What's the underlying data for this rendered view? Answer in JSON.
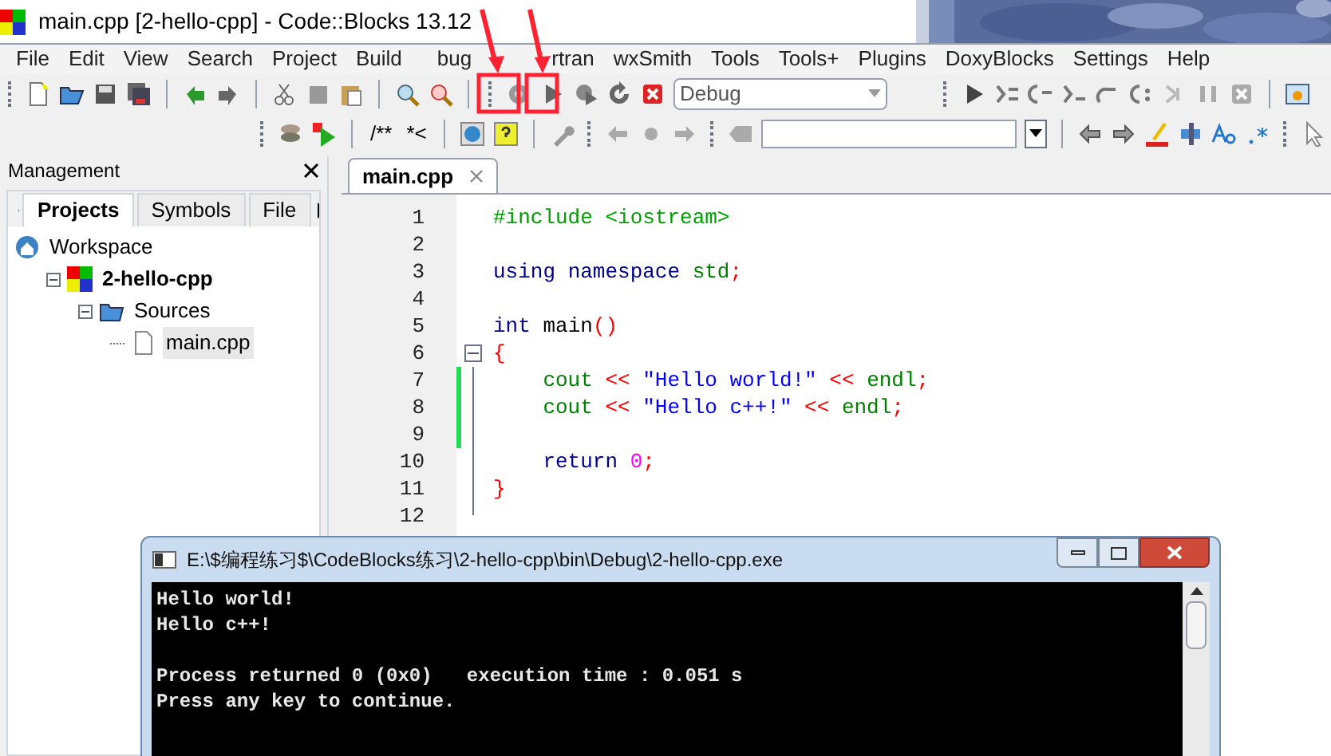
{
  "window": {
    "title": "main.cpp [2-hello-cpp] - Code::Blocks 13.12"
  },
  "menu": [
    "File",
    "Edit",
    "View",
    "Search",
    "Project",
    "Build",
    "bug",
    "rtran",
    "wxSmith",
    "Tools",
    "Tools+",
    "Plugins",
    "DoxyBlocks",
    "Settings",
    "Help"
  ],
  "toolbar": {
    "build_target": "Debug",
    "comment_buttons": [
      "/**",
      "*<"
    ]
  },
  "management": {
    "title": "Management",
    "tabs": [
      {
        "label": "Projects",
        "selected": true
      },
      {
        "label": "Symbols",
        "selected": false
      },
      {
        "label": "File",
        "selected": false
      }
    ],
    "tree": [
      {
        "label": "Workspace",
        "kind": "workspace",
        "selected": false,
        "children": [
          {
            "label": "2-hello-cpp",
            "kind": "project",
            "selected": false,
            "children": [
              {
                "label": "Sources",
                "kind": "folder",
                "selected": false,
                "children": [
                  {
                    "label": "main.cpp",
                    "kind": "file",
                    "selected": true
                  }
                ]
              }
            ]
          }
        ]
      }
    ]
  },
  "editor": {
    "tabs": [
      {
        "label": "main.cpp",
        "selected": true
      }
    ],
    "lines": [
      {
        "number": "1",
        "changed": false,
        "fold": false,
        "tokens": [
          {
            "kind": "preprocessor",
            "text": "#include <iostream>"
          }
        ]
      },
      {
        "number": "2",
        "changed": false,
        "fold": false
      },
      {
        "number": "3",
        "changed": false,
        "fold": false,
        "tokens": [
          {
            "kind": "keyword",
            "text": "using "
          },
          {
            "kind": "keyword",
            "text": "namespace "
          },
          {
            "kind": "builtin",
            "text": "std"
          },
          {
            "kind": "operator",
            "text": ";"
          }
        ]
      },
      {
        "number": "4",
        "changed": false,
        "fold": false
      },
      {
        "number": "5",
        "changed": false,
        "fold": false,
        "tokens": [
          {
            "kind": "keyword",
            "text": "int "
          },
          {
            "kind": "identifier",
            "text": "main"
          },
          {
            "kind": "operator",
            "text": "()"
          }
        ]
      },
      {
        "number": "6",
        "changed": false,
        "fold": true,
        "tokens": [
          {
            "kind": "operator",
            "text": "{"
          }
        ]
      },
      {
        "number": "7",
        "changed": true,
        "fold": false,
        "tokens": [
          {
            "kind": "builtin",
            "text": "    cout "
          },
          {
            "kind": "operator",
            "text": "<< "
          },
          {
            "kind": "string",
            "text": "\"Hello world!\" "
          },
          {
            "kind": "operator",
            "text": "<< "
          },
          {
            "kind": "builtin",
            "text": "endl"
          },
          {
            "kind": "operator",
            "text": ";"
          }
        ]
      },
      {
        "number": "8",
        "changed": true,
        "fold": false,
        "tokens": [
          {
            "kind": "builtin",
            "text": "    cout "
          },
          {
            "kind": "operator",
            "text": "<< "
          },
          {
            "kind": "string",
            "text": "\"Hello c++!\" "
          },
          {
            "kind": "operator",
            "text": "<< "
          },
          {
            "kind": "builtin",
            "text": "endl"
          },
          {
            "kind": "operator",
            "text": ";"
          }
        ]
      },
      {
        "number": "9",
        "changed": true,
        "fold": false
      },
      {
        "number": "10",
        "changed": false,
        "fold": false,
        "tokens": [
          {
            "kind": "keyword",
            "text": "    return "
          },
          {
            "kind": "number",
            "text": "0"
          },
          {
            "kind": "operator",
            "text": ";"
          }
        ]
      },
      {
        "number": "11",
        "changed": false,
        "fold": false,
        "tokens": [
          {
            "kind": "operator",
            "text": "}"
          }
        ]
      },
      {
        "number": "12",
        "changed": false,
        "fold": false
      }
    ]
  },
  "console": {
    "title": "E:\\$编程练习$\\CodeBlocks练习\\2-hello-cpp\\bin\\Debug\\2-hello-cpp.exe",
    "blocks": [
      [
        "Hello world!",
        "Hello c++!"
      ],
      [
        "Process returned 0 (0x0)   execution time : 0.051 s",
        "Press any key to continue."
      ]
    ]
  }
}
